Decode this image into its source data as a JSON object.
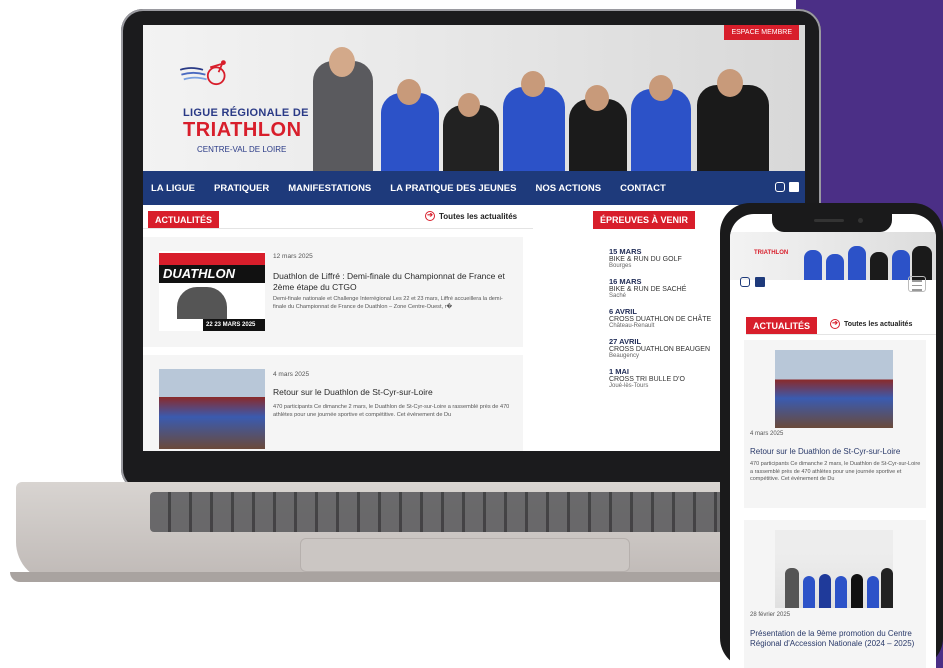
{
  "site": {
    "logo": {
      "line1": "LIGUE RÉGIONALE DE",
      "line2": "TRIATHLON",
      "line3": "CENTRE-VAL DE LOIRE"
    },
    "espace_membre": "ESPACE MEMBRE",
    "nav": [
      "LA LIGUE",
      "PRATIQUER",
      "MANIFESTATIONS",
      "LA PRATIQUE DES JEUNES",
      "NOS ACTIONS",
      "CONTACT"
    ],
    "nav_icons": [
      "instagram-icon",
      "facebook-icon"
    ],
    "actualites_label": "ACTUALITÉS",
    "toutes_label": "Toutes les actualités",
    "epreuves_label": "ÉPREUVES À VENIR",
    "articles": [
      {
        "date": "12 mars 2025",
        "title": "Duathlon de Liffré : Demi-finale du Championnat de France et 2ème étape du CTGO",
        "excerpt": "Demi-finale nationale et Challenge Interrégional Les 22 et 23 mars, Liffré accueillera la demi-finale du Championnat de France de Duathlon – Zone Centre-Ouest, r�",
        "thumb_text": "DUATHLON",
        "thumb_date": "22 23 MARS 2025"
      },
      {
        "date": "4 mars 2025",
        "title": "Retour sur le Duathlon de St-Cyr-sur-Loire",
        "excerpt": "470 participants Ce dimanche 2 mars, le Duathlon de St-Cyr-sur-Loire a rassemblé près de 470 athlètes pour une journée sportive et compétitive. Cet événement de Du"
      }
    ],
    "events": [
      {
        "date": "15 MARS",
        "name": "BIKE & RUN DU GOLF",
        "place": "Bourges"
      },
      {
        "date": "16 MARS",
        "name": "BIKE & RUN DE SACHÉ",
        "place": "Saché"
      },
      {
        "date": "6 AVRIL",
        "name": "CROSS DUATHLON DE CHÂTE",
        "place": "Château-Renault"
      },
      {
        "date": "27 AVRIL",
        "name": "CROSS DUATHLON BEAUGEN",
        "place": "Beaugency"
      },
      {
        "date": "1 MAI",
        "name": "CROSS TRI BULLE D'O",
        "place": "Joué-lès-Tours"
      }
    ]
  },
  "phone": {
    "logo": "TRIATHLON",
    "actualites_label": "ACTUALITÉS",
    "toutes_label": "Toutes les actualités",
    "articles": [
      {
        "date": "4 mars 2025",
        "title": "Retour sur le Duathlon de St-Cyr-sur-Loire",
        "excerpt": "470 participants Ce dimanche 2 mars, le Duathlon de St-Cyr-sur-Loire a rassemblé près de 470 athlètes pour une journée sportive et compétitive. Cet événement de Du"
      },
      {
        "date": "28 février 2025",
        "title": "Présentation de la 9ème promotion du Centre Régional d'Accession Nationale (2024 – 2025)"
      }
    ]
  },
  "colors": {
    "brand_red": "#d81e2b",
    "nav_blue": "#1e3a7b",
    "background_purple": "#4b2f86"
  }
}
